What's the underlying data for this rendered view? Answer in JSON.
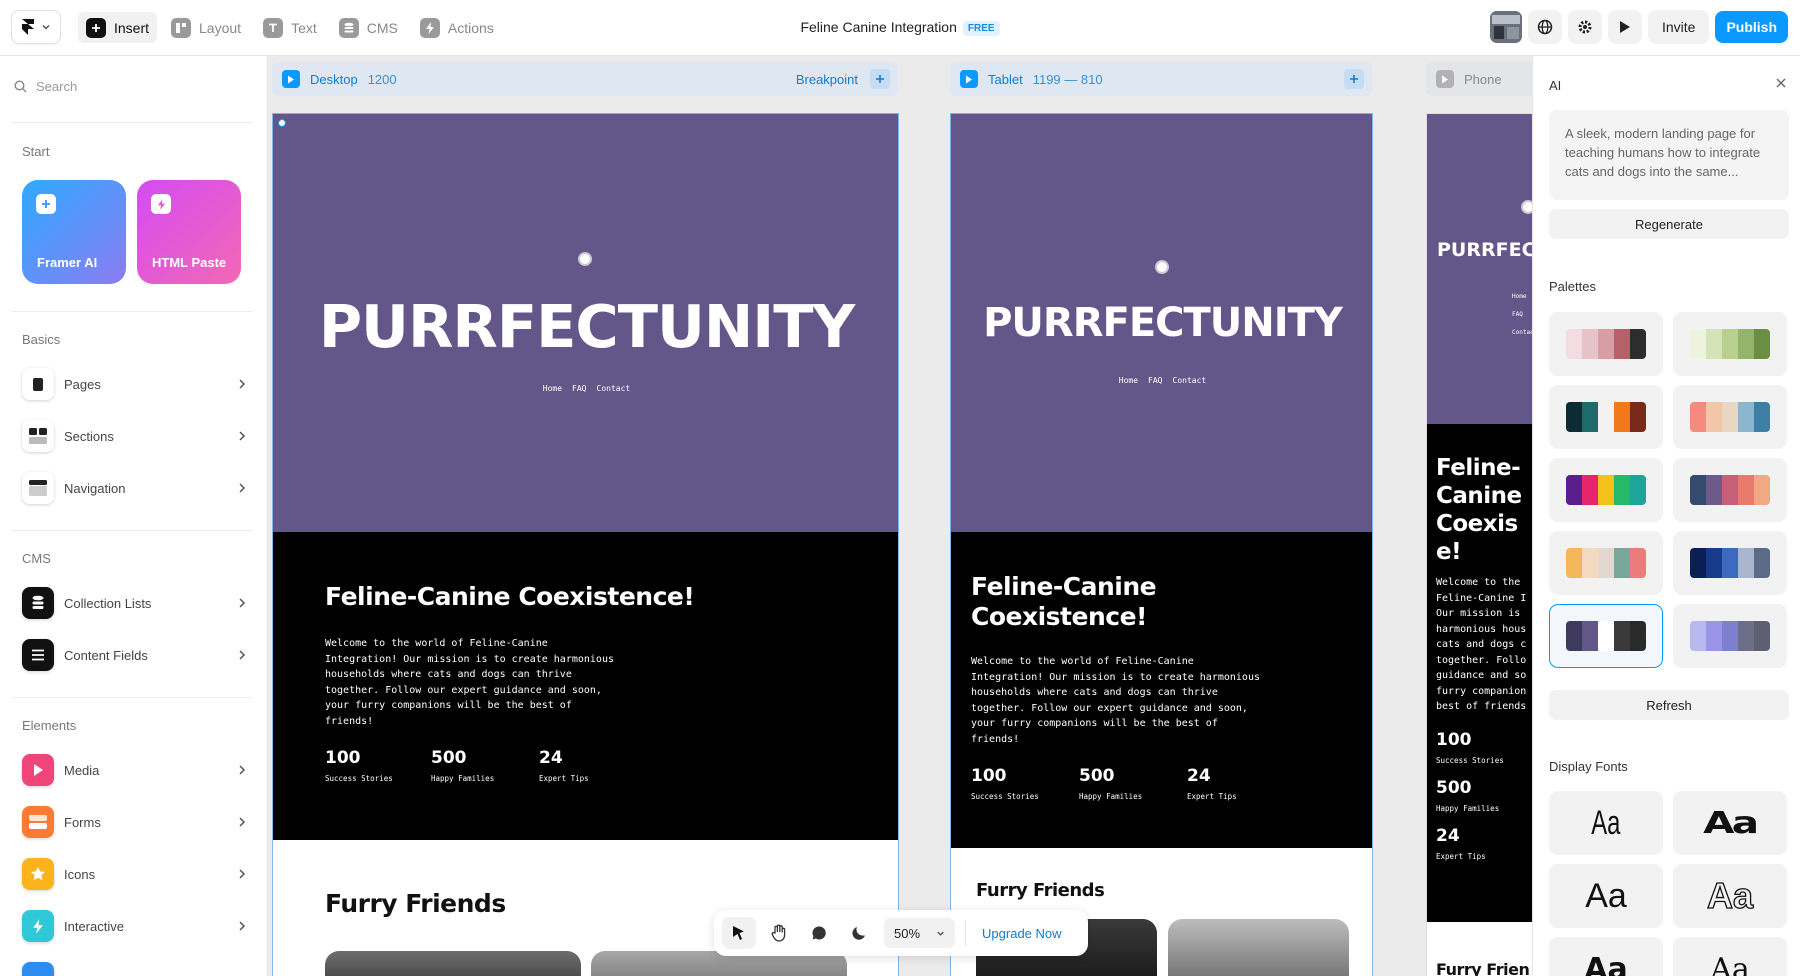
{
  "topbar": {
    "tools": [
      {
        "label": "Insert",
        "icon": "plus-square-icon",
        "active": true
      },
      {
        "label": "Layout",
        "icon": "layout-icon",
        "active": false
      },
      {
        "label": "Text",
        "icon": "text-icon",
        "active": false
      },
      {
        "label": "CMS",
        "icon": "database-icon",
        "active": false
      },
      {
        "label": "Actions",
        "icon": "bolt-icon",
        "active": false
      }
    ],
    "project_title": "Feline Canine Integration",
    "plan_badge": "FREE",
    "invite_label": "Invite",
    "publish_label": "Publish"
  },
  "left": {
    "search_placeholder": "Search",
    "start_title": "Start",
    "cards": [
      {
        "label": "Framer AI",
        "gradient": [
          "#3aa7ff",
          "#8b7cf5"
        ]
      },
      {
        "label": "HTML Paste",
        "gradient": [
          "#d64ef0",
          "#f266b8"
        ]
      }
    ],
    "basics_title": "Basics",
    "basics": [
      "Pages",
      "Sections",
      "Navigation"
    ],
    "cms_title": "CMS",
    "cms": [
      "Collection Lists",
      "Content Fields"
    ],
    "elements_title": "Elements",
    "elements": [
      {
        "label": "Media",
        "color": "#f0457a"
      },
      {
        "label": "Forms",
        "color": "#fb7b32"
      },
      {
        "label": "Icons",
        "color": "#fbb21b"
      },
      {
        "label": "Interactive",
        "color": "#2ec8d6"
      }
    ]
  },
  "canvas": {
    "breakpoints": [
      {
        "name": "Desktop",
        "size": "1200",
        "extra": "Breakpoint"
      },
      {
        "name": "Tablet",
        "size": "1199 — 810"
      },
      {
        "name": "Phone"
      }
    ],
    "site": {
      "hero_title": "PURRFECTUNITY",
      "hero_title_phone": "PURRFEC",
      "nav": [
        "Home",
        "FAQ",
        "Contact"
      ],
      "heading": "Feline-Canine Coexistence!",
      "heading_tablet_l1": "Feline-Canine",
      "heading_tablet_l2": "Coexistence!",
      "heading_phone": [
        "Feline-",
        "Canine",
        "Coexis",
        "e!"
      ],
      "intro_lines": [
        "Welcome to the world of Feline-Canine",
        "Integration! Our mission is to create harmonious",
        "households where cats and dogs can thrive",
        "together. Follow our expert guidance and soon,",
        "your furry companions will be the best of",
        "friends!"
      ],
      "intro_phone": [
        "Welcome to the",
        "Feline-Canine I",
        "Our mission is",
        "harmonious hous",
        "cats and dogs c",
        "together. Follo",
        "guidance and so",
        "furry companion",
        "best of friends"
      ],
      "stats": [
        {
          "value": "100",
          "label": "Success Stories"
        },
        {
          "value": "500",
          "label": "Happy Families"
        },
        {
          "value": "24",
          "label": "Expert Tips"
        }
      ],
      "section2": "Furry Friends",
      "section2_phone": "Furry Frien",
      "colors": {
        "hero": "#625788",
        "dark": "#000000"
      }
    },
    "bottom_toolbar": {
      "zoom": "50%",
      "upgrade": "Upgrade Now"
    }
  },
  "right": {
    "title": "AI",
    "prompt": "A sleek, modern landing page for teaching humans how to integrate cats and dogs into the same...",
    "regenerate": "Regenerate",
    "palettes_title": "Palettes",
    "palettes": [
      [
        "#f4dde1",
        "#e6c3c8",
        "#d79ea6",
        "#b8606a",
        "#2d2d2d"
      ],
      [
        "#eef3de",
        "#d5e3b8",
        "#b8d090",
        "#94b46b",
        "#6b8e45"
      ],
      [
        "#0d2b32",
        "#1e6b6b",
        "#f2f2f2",
        "#f07a1a",
        "#7a2a18"
      ],
      [
        "#f38c7e",
        "#f2c6a8",
        "#e9d7c3",
        "#8ab6cf",
        "#3e7fa8"
      ],
      [
        "#5b1e8f",
        "#e8246b",
        "#f5c21b",
        "#26b96a",
        "#1ea59a"
      ],
      [
        "#354a6e",
        "#6b5a8a",
        "#c56076",
        "#e97a6e",
        "#f2a883"
      ],
      [
        "#f4b85a",
        "#f3dac0",
        "#e3d8d0",
        "#79a89a",
        "#ee7b7b"
      ],
      [
        "#0a1f55",
        "#173a8a",
        "#3d6ac0",
        "#a9b6cd",
        "#5c6b85"
      ],
      [
        "#3d3a5e",
        "#625788",
        "#ffffff",
        "#3a3a3a",
        "#2a2a2a"
      ],
      [
        "#b7b9f0",
        "#9a95e6",
        "#7d7fcf",
        "#6c6f86",
        "#5e5f70"
      ]
    ],
    "refresh": "Refresh",
    "fonts_title": "Display Fonts",
    "font_samples": [
      "Aa",
      "Aa",
      "Aa",
      "Aa",
      "Aa",
      "Aa"
    ]
  }
}
